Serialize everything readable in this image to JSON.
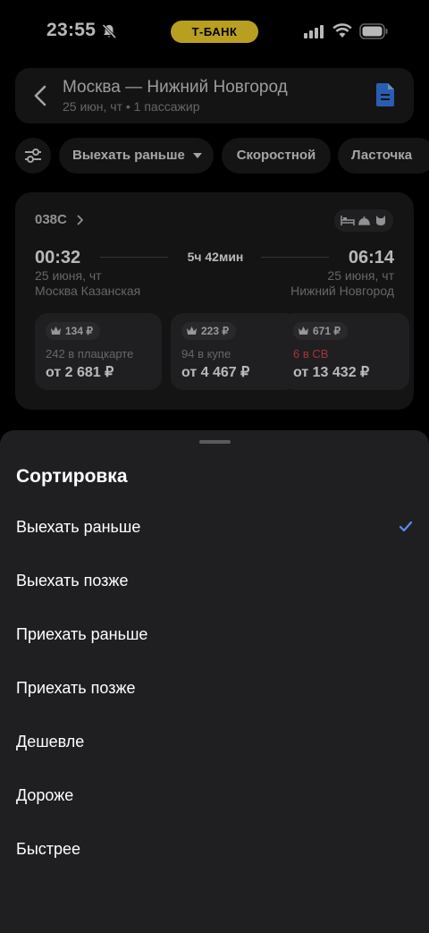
{
  "status_bar": {
    "time": "23:55",
    "bank_label": "Т-БАНК",
    "icons": [
      "bell-slash-icon",
      "signal-icon",
      "wifi-icon",
      "battery-icon"
    ]
  },
  "header": {
    "title": "Москва — Нижний Новгород",
    "subtitle": "25 июн, чт • 1 пассажир",
    "icons": [
      "back-arrow-icon",
      "document-icon"
    ]
  },
  "filters": {
    "settings_icon": "filter-sliders-icon",
    "sort_label": "Выехать раньше",
    "chips": [
      "Скоростной",
      "Ласточка"
    ]
  },
  "train": {
    "number": "038С",
    "departure": {
      "time": "00:32",
      "date": "25 июня, чт",
      "station": "Москва Казанская"
    },
    "duration": "5ч 42мин",
    "arrival": {
      "time": "06:14",
      "date": "25 июня, чт",
      "station": "Нижний Новгород"
    },
    "amenities": [
      "bed-icon",
      "meal-icon",
      "pet-icon"
    ],
    "fares": [
      {
        "bonus": "134 ₽",
        "seats": "242 в плацкарте",
        "price": "от 2 681 ₽",
        "seats_color": "#8e8e93"
      },
      {
        "bonus": "223 ₽",
        "seats": "94 в купе",
        "price": "от 4 467 ₽",
        "seats_color": "#8e8e93"
      },
      {
        "bonus": "671 ₽",
        "seats": "6 в СВ",
        "price": "от 13 432 ₽",
        "seats_color": "#e5484d"
      }
    ]
  },
  "sort_sheet": {
    "title": "Сортировка",
    "options": [
      {
        "label": "Выехать раньше",
        "selected": true
      },
      {
        "label": "Выехать позже",
        "selected": false
      },
      {
        "label": "Приехать раньше",
        "selected": false
      },
      {
        "label": "Приехать позже",
        "selected": false
      },
      {
        "label": "Дешевле",
        "selected": false
      },
      {
        "label": "Дороже",
        "selected": false
      },
      {
        "label": "Быстрее",
        "selected": false
      }
    ],
    "check_color": "#5b8def"
  },
  "colors": {
    "accent_yellow": "#ffdd2d",
    "doc_blue": "#3b82f6",
    "check_blue": "#5b8def"
  }
}
